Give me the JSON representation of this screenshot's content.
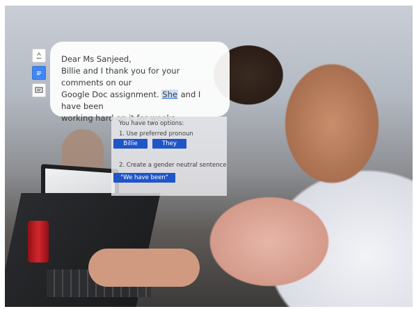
{
  "letter": {
    "greeting": "Dear Ms Sanjeed,",
    "line1": "Billie and I thank you for your comments on our",
    "line2_before": "Google Doc assignment. ",
    "line2_highlight": "She",
    "line2_after": " and I have been",
    "line3": "working hard on it for weeks."
  },
  "suggestions": {
    "intro": "You have two options:",
    "option1": "1. Use preferred pronoun",
    "option1_choices": [
      "Billie",
      "They"
    ],
    "option2": "2. Create a gender neutral sentence",
    "option2_choice": "\"We have been\""
  },
  "icons": [
    "recycle-icon",
    "google-docs-icon",
    "comment-icon"
  ],
  "colors": {
    "accent": "#1f55c7",
    "highlight": "#cde0f7"
  }
}
